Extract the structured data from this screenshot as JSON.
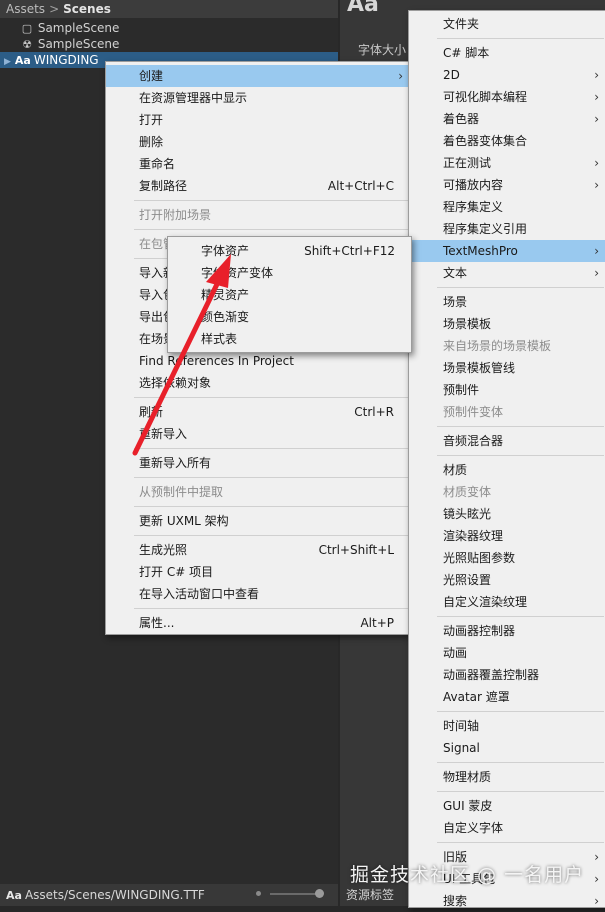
{
  "project": {
    "breadcrumb": {
      "root": "Assets",
      "current": "Scenes"
    },
    "items": [
      {
        "label": "SampleScene",
        "icon": "folder-icon",
        "glyph": "▢"
      },
      {
        "label": "SampleScene",
        "icon": "unity-scene-icon",
        "glyph": "☢"
      },
      {
        "label": "WINGDING",
        "icon": "font-icon",
        "glyph": "Aa",
        "selected": true
      }
    ],
    "path": {
      "icon_text": "Aa",
      "text": "Assets/Scenes/WINGDING.TTF"
    }
  },
  "inspector": {
    "title": "Aa",
    "font_size_label": "字体大小",
    "asset_tag": "资源标签"
  },
  "context_menu": {
    "items": [
      {
        "label": "创建",
        "arrow": true,
        "highlight": true
      },
      {
        "label": "在资源管理器中显示"
      },
      {
        "label": "打开"
      },
      {
        "label": "删除"
      },
      {
        "label": "重命名"
      },
      {
        "label": "复制路径",
        "shortcut": "Alt+Ctrl+C"
      },
      {
        "label": "打开附加场景",
        "disabled": true,
        "sep_before": true
      },
      {
        "label": "在包管理器中查看",
        "disabled": true,
        "sep_before": true
      },
      {
        "label": "导入新资源...",
        "sep_before": true
      },
      {
        "label": "导入包"
      },
      {
        "label": "导出包..."
      },
      {
        "label": "在场景中查找引用"
      },
      {
        "label": "Find References In Project"
      },
      {
        "label": "选择依赖对象"
      },
      {
        "label": "刷新",
        "shortcut": "Ctrl+R",
        "sep_before": true
      },
      {
        "label": "重新导入"
      },
      {
        "label": "重新导入所有",
        "sep_before": true
      },
      {
        "label": "从预制件中提取",
        "disabled": true,
        "sep_before": true
      },
      {
        "label": "更新 UXML 架构",
        "sep_before": true
      },
      {
        "label": "生成光照",
        "shortcut": "Ctrl+Shift+L",
        "sep_before": true
      },
      {
        "label": "打开 C# 项目"
      },
      {
        "label": "在导入活动窗口中查看"
      },
      {
        "label": "属性...",
        "shortcut": "Alt+P",
        "sep_before": true
      }
    ]
  },
  "textmeshpro_menu": {
    "items": [
      {
        "label": "字体资产",
        "shortcut": "Shift+Ctrl+F12"
      },
      {
        "label": "字体资产变体"
      },
      {
        "label": "精灵资产"
      },
      {
        "label": "颜色渐变"
      },
      {
        "label": "样式表"
      }
    ]
  },
  "create_menu": {
    "items": [
      {
        "label": "文件夹"
      },
      {
        "label": "C# 脚本",
        "sep_before": true
      },
      {
        "label": "2D",
        "arrow": true
      },
      {
        "label": "可视化脚本编程",
        "arrow": true
      },
      {
        "label": "着色器",
        "arrow": true
      },
      {
        "label": "着色器变体集合"
      },
      {
        "label": "正在测试",
        "arrow": true
      },
      {
        "label": "可播放内容",
        "arrow": true
      },
      {
        "label": "程序集定义"
      },
      {
        "label": "程序集定义引用"
      },
      {
        "label": "TextMeshPro",
        "arrow": true,
        "highlight": true
      },
      {
        "label": "文本",
        "arrow": true
      },
      {
        "label": "场景",
        "sep_before": true
      },
      {
        "label": "场景模板"
      },
      {
        "label": "来自场景的场景模板",
        "disabled": true
      },
      {
        "label": "场景模板管线"
      },
      {
        "label": "预制件"
      },
      {
        "label": "预制件变体",
        "disabled": true
      },
      {
        "label": "音频混合器",
        "sep_before": true
      },
      {
        "label": "材质",
        "sep_before": true
      },
      {
        "label": "材质变体",
        "disabled": true
      },
      {
        "label": "镜头眩光"
      },
      {
        "label": "渲染器纹理"
      },
      {
        "label": "光照贴图参数"
      },
      {
        "label": "光照设置"
      },
      {
        "label": "自定义渲染纹理"
      },
      {
        "label": "动画器控制器",
        "sep_before": true
      },
      {
        "label": "动画"
      },
      {
        "label": "动画器覆盖控制器"
      },
      {
        "label": "Avatar 遮罩"
      },
      {
        "label": "时间轴",
        "sep_before": true
      },
      {
        "label": "Signal"
      },
      {
        "label": "物理材质",
        "sep_before": true
      },
      {
        "label": "GUI 蒙皮",
        "sep_before": true
      },
      {
        "label": "自定义字体"
      },
      {
        "label": "旧版",
        "arrow": true,
        "sep_before": true
      },
      {
        "label": "UI 工具包",
        "arrow": true
      },
      {
        "label": "搜索",
        "arrow": true
      }
    ]
  },
  "arrow_glyph": "›",
  "watermark": "掘金技术社区 @ 一名用户",
  "colors": {
    "menu_bg": "#f0f0f0",
    "highlight": "#99c9ef",
    "selection": "#2c5d87",
    "annotation_arrow": "#e8202a"
  }
}
